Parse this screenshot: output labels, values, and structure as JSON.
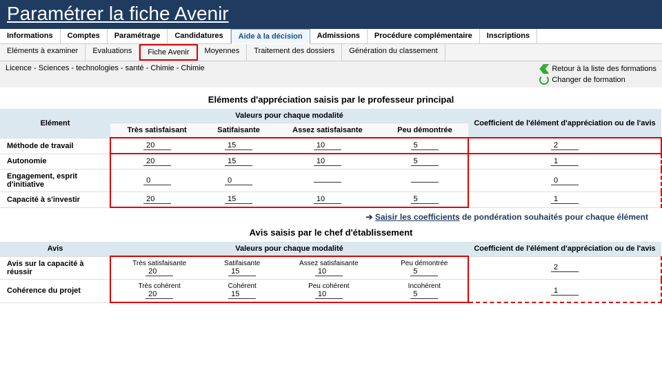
{
  "slide": {
    "title": "Paramétrer la fiche Avenir"
  },
  "nav1": {
    "items": [
      "Informations",
      "Comptes",
      "Paramétrage",
      "Candidatures",
      "Aide à la décision",
      "Admissions",
      "Procédure complémentaire",
      "Inscriptions"
    ],
    "active": 4
  },
  "nav2": {
    "items": [
      "Eléments à examiner",
      "Evaluations",
      "Fiche Avenir",
      "Moyennes",
      "Traitement des dossiers",
      "Génération du classement"
    ],
    "active": 2
  },
  "breadcrumb": "Licence - Sciences - technologies - santé - Chimie - Chimie",
  "actions": {
    "back": "Retour à la liste des formations",
    "change": "Changer de formation"
  },
  "section1": {
    "title": "Eléments d'appréciation saisis par le professeur principal",
    "col_element": "Elément",
    "col_values": "Valeurs pour chaque modalité",
    "col_coef": "Coefficient de l'élément d'appréciation ou de l'avis",
    "sub": [
      "Très satisfaisant",
      "Satifaisante",
      "Assez satisfaisante",
      "Peu démontrée"
    ],
    "rows": [
      {
        "label": "Méthode de travail",
        "v": [
          "20",
          "15",
          "10",
          "5"
        ],
        "coef": "2"
      },
      {
        "label": "Autonomie",
        "v": [
          "20",
          "15",
          "10",
          "5"
        ],
        "coef": "1"
      },
      {
        "label": "Engagement, esprit d'initiative",
        "v": [
          "0",
          "0",
          "",
          ""
        ],
        "coef": "0"
      },
      {
        "label": "Capacité à s'investir",
        "v": [
          "20",
          "15",
          "10",
          "5"
        ],
        "coef": "1"
      }
    ]
  },
  "callout": {
    "arrow": "➔",
    "head": "Saisir les coefficients",
    "rest": " de pondération souhaités pour chaque élément"
  },
  "section2": {
    "title": "Avis saisis par le chef d'établissement",
    "col_element": "Avis",
    "col_values": "Valeurs pour chaque modalité",
    "col_coef": "Coefficient de l'élément d'appréciation ou de l'avis",
    "rows": [
      {
        "label": "Avis sur la capacité à réussir",
        "sub": [
          "Très satisfaisante",
          "Satifaisante",
          "Assez satisfaisante",
          "Peu démontrée"
        ],
        "v": [
          "20",
          "15",
          "10",
          "5"
        ],
        "coef": "2"
      },
      {
        "label": "Cohérence du projet",
        "sub": [
          "Très cohérent",
          "Cohérent",
          "Peu cohérent",
          "Incohérent"
        ],
        "v": [
          "20",
          "15",
          "10",
          "5"
        ],
        "coef": "1"
      }
    ]
  }
}
